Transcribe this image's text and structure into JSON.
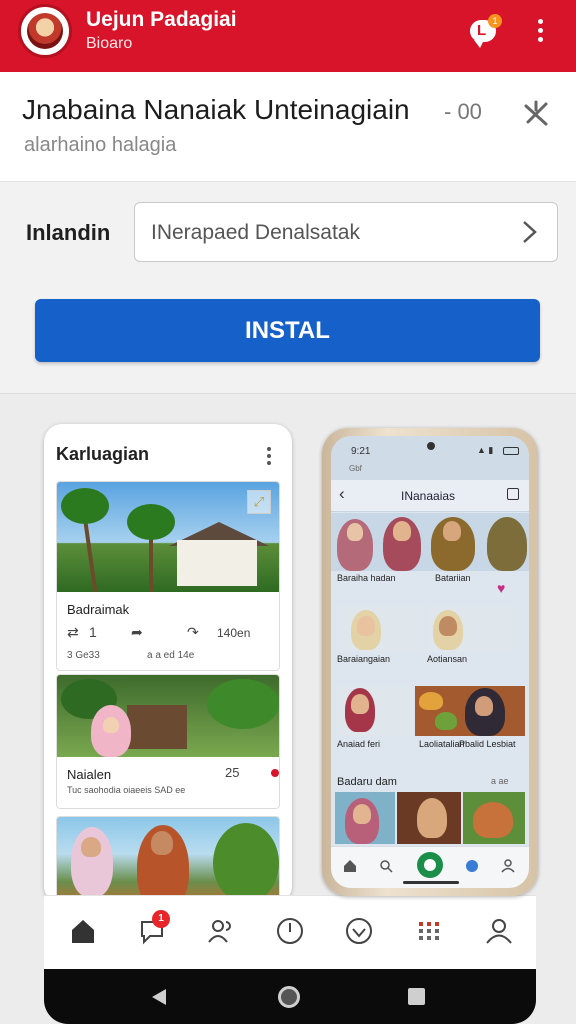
{
  "header": {
    "app_title": "Uejun Padagiai",
    "app_subtitle": "Bioaro",
    "notification_badge": "1"
  },
  "listing": {
    "title": "Jnabaina Nanaiak Unteinagiain",
    "version": "- 00",
    "subtitle": "alarhaino halagia"
  },
  "install_row": {
    "label": "Inlandin",
    "select_value": "INerapaed Denalsatak",
    "install_button": "INSTAL"
  },
  "left_preview": {
    "header": "Karluagian",
    "posts": [
      {
        "title": "Badraimak",
        "actions": [
          "1",
          "1",
          "140en"
        ],
        "meta_left": "3 Ge33",
        "meta_right": "a a ed 14e"
      },
      {
        "title": "Naialen",
        "tags": "Tuc saohodia oiaeeis  SAD ee",
        "time": "25"
      },
      {
        "title": ""
      }
    ]
  },
  "right_preview": {
    "status_time": "9:21",
    "status_sub": "Gbf",
    "title": "INanaaias",
    "captions": [
      "Baraiha hadan",
      "Batariian",
      "Baraiangaian",
      "Aotiansan",
      "Anaiad feri",
      "Laoliatalian",
      "Pbalid Lesbiat"
    ],
    "section_title": "Badaru dam",
    "section_sub": "a ae"
  },
  "bottom_nav": {
    "items": [
      "home",
      "chat",
      "people",
      "clock",
      "heart",
      "grid",
      "user"
    ],
    "chat_badge": "1"
  },
  "colors": {
    "brand_red": "#d7142a",
    "install_blue": "#1660c9"
  }
}
